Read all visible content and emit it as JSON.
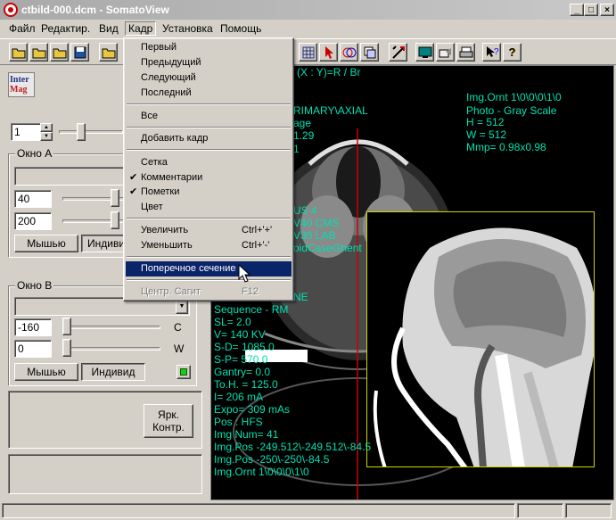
{
  "window": {
    "title": "ctbild-000.dcm - SomatoView"
  },
  "menubar": {
    "items": [
      "Файл",
      "Редактир.",
      "Вид",
      "Кадр",
      "Установка",
      "Помощь"
    ]
  },
  "dropdown": {
    "items": [
      {
        "label": "Первый",
        "shortcut": ""
      },
      {
        "label": "Предыдущий",
        "shortcut": ""
      },
      {
        "label": "Следующий",
        "shortcut": ""
      },
      {
        "label": "Последний",
        "shortcut": ""
      },
      {
        "label": "Все",
        "shortcut": ""
      },
      {
        "label": "Добавить кадр",
        "shortcut": ""
      },
      {
        "label": "Сетка",
        "shortcut": ""
      },
      {
        "label": "Комментарии",
        "shortcut": "",
        "checked": true
      },
      {
        "label": "Пометки",
        "shortcut": "",
        "checked": true
      },
      {
        "label": "Цвет",
        "shortcut": ""
      },
      {
        "label": "Увеличить",
        "shortcut": "Ctrl+'+'"
      },
      {
        "label": "Уменьшить",
        "shortcut": "Ctrl+'-'"
      },
      {
        "label": "Поперечное сечение",
        "shortcut": "",
        "selected": true
      },
      {
        "label": "Центр. Сагит",
        "shortcut": "F12",
        "disabled": true
      }
    ]
  },
  "left": {
    "logo": {
      "line1": "Inter",
      "line2": "Mag"
    },
    "frame_value": "1",
    "window_a": {
      "title": "Окно A",
      "value1": "40",
      "value2": "200",
      "btn_mouse": "Мышью",
      "btn_indiv": "Индивид"
    },
    "window_b": {
      "title": "Окно B",
      "value1": "-160",
      "value2": "0",
      "label_c": "C",
      "label_w": "W",
      "btn_mouse": "Мышью",
      "btn_indiv": "Индивид"
    },
    "bright_btn": {
      "line1": "Ярк.",
      "line2": "Контр."
    }
  },
  "overlay": {
    "top_center": "(X : Y)=R / Br",
    "left_lines": [
      "RIMARY\\AXIAL",
      "age",
      "1.29",
      "1",
      "US 4",
      "V40  CMS",
      "V30  LAB",
      "oidCaseGhent"
    ],
    "right_lines": [
      "Img.Ornt 1\\0\\0\\0\\1\\0",
      "Photo - Gray Scale",
      "H     = 512",
      "W     = 512",
      "Mmp= 0.98x0.98"
    ],
    "bottom_lines": [
      "NE",
      "Sequence - RM",
      "SL=  2.0",
      "V= 140 KV",
      "S-D= 1085.0",
      "S-P= 570.0",
      "Gantry=  0.0",
      "To.H. = 125.0",
      "I= 206 mA",
      "Expo= 309 mAs",
      "Pos : HFS",
      "Img Num= 41",
      "Img.Pos -249.512\\-249.512\\-84.5",
      "Img.Pos -250\\-250\\-84.5",
      "Img.Ornt 1\\0\\0\\0\\1\\0"
    ]
  },
  "icons": {
    "toolbar_left": [
      "open-folder-icon",
      "open-folder2-icon",
      "open-folder3-icon",
      "save-disk-icon",
      "open-folder4-icon"
    ],
    "toolbar_right": [
      "grid-icon",
      "cursor-icon",
      "color-icon",
      "layer-icon",
      "measure-icon",
      "monitor-icon",
      "export-icon",
      "print-icon",
      "help-cursor-icon",
      "help-icon"
    ]
  },
  "colors": {
    "overlay_text": "#00e0b0",
    "menu_highlight": "#0a246a",
    "sagittal_border": "#d6d200"
  }
}
